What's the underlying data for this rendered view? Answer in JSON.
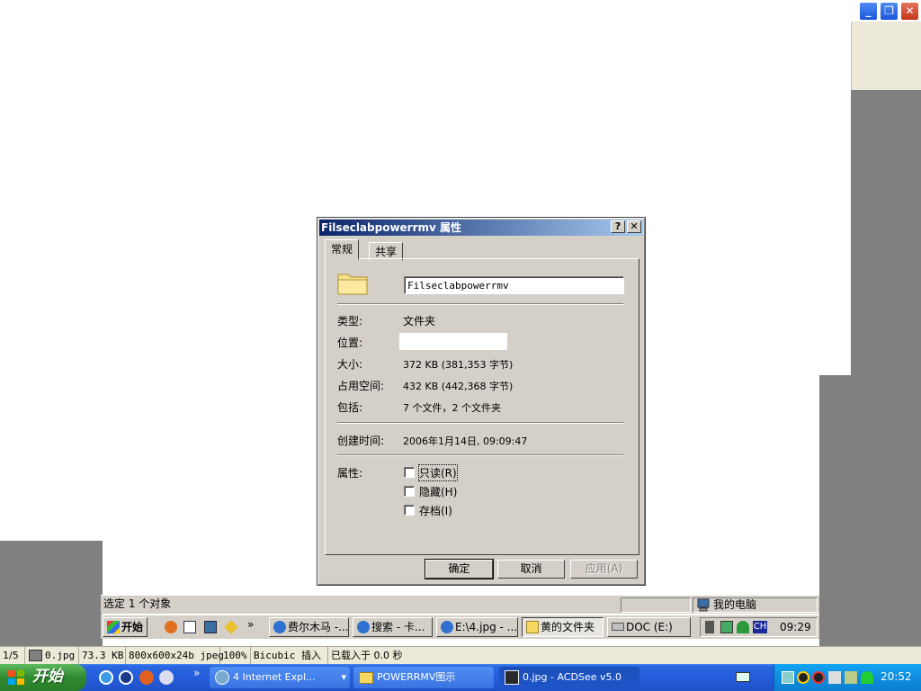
{
  "dialog": {
    "title": "Filseclabpowerrmv 属性",
    "help_btn": "?",
    "close_btn": "✕",
    "tabs": [
      {
        "label": "常规"
      },
      {
        "label": "共享"
      }
    ],
    "name_value": "Filseclabpowerrmv",
    "rows": {
      "type": {
        "label": "类型:",
        "value": "文件夹"
      },
      "location": {
        "label": "位置:",
        "value": ""
      },
      "size": {
        "label": "大小:",
        "value": "372 KB (381,353 字节)"
      },
      "size_on_disk": {
        "label": "占用空间:",
        "value": "432 KB (442,368 字节)"
      },
      "contains": {
        "label": "包括:",
        "value": "7 个文件，2 个文件夹"
      },
      "created": {
        "label": "创建时间:",
        "value": "2006年1月14日, 09:09:47"
      }
    },
    "attributes_label": "属性:",
    "attributes": [
      {
        "label": "只读(R)",
        "checked": false
      },
      {
        "label": "隐藏(H)",
        "checked": false
      },
      {
        "label": "存档(I)",
        "checked": false
      }
    ],
    "buttons": {
      "ok": "确定",
      "cancel": "取消",
      "apply": "应用(A)"
    }
  },
  "inner_statusbar": {
    "selection": "选定 1 个对象",
    "location": "我的电脑"
  },
  "inner_taskbar": {
    "start": "开始",
    "more": "»",
    "tasks": [
      {
        "label": "费尔木马 -..."
      },
      {
        "label": "搜索 - 卡..."
      },
      {
        "label": "E:\\4.jpg - ..."
      },
      {
        "label": "黄的文件夹"
      },
      {
        "label": "DOC (E:)"
      }
    ],
    "tray_lang": "CH",
    "clock": "09:29"
  },
  "acdsee_status": {
    "index": "1/5",
    "filename": "0.jpg",
    "filesize": "73.3 KB",
    "dimensions": "800x600x24b jpeg",
    "zoom": "100%",
    "filter": "Bicubic 插入",
    "load": "已载入于 0.0 秒"
  },
  "xp_taskbar": {
    "start": "开始",
    "more": "»",
    "tasks": [
      {
        "label": "4 Internet Expl...",
        "dropdown": "▾"
      },
      {
        "label": "POWERRMV图示"
      },
      {
        "label": "0.jpg - ACDSee v5.0"
      }
    ],
    "clock": "20:52"
  },
  "window_controls": {
    "minimize": "_",
    "restore": "❐",
    "close": "✕"
  },
  "colors": {
    "xp_blue": "#245ddb",
    "dialog_face": "#d4d0c8",
    "title_dark": "#0a246a",
    "title_light": "#a6caf0"
  }
}
